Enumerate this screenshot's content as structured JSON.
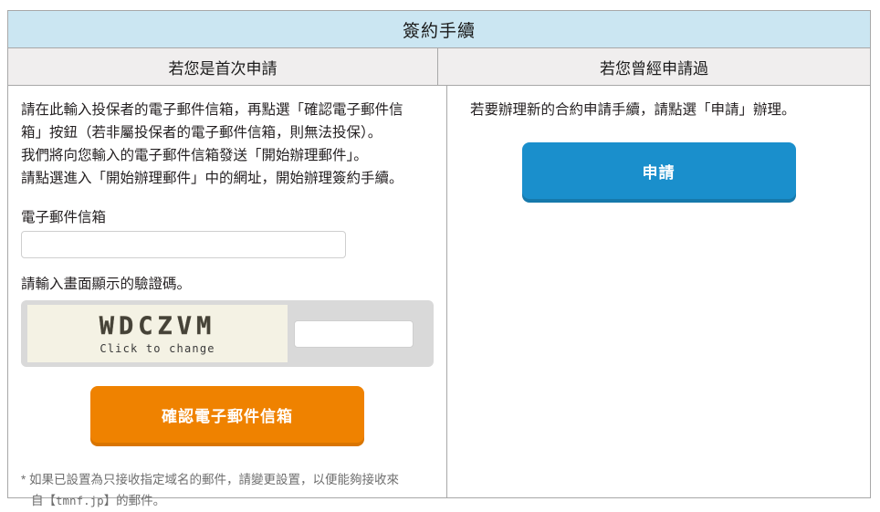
{
  "page": {
    "title": "簽約手續"
  },
  "columns": {
    "left_heading": "若您是首次申請",
    "right_heading": "若您曾經申請過"
  },
  "left": {
    "intro_lines": [
      "請在此輸入投保者的電子郵件信箱，再點選「確認電子郵件信",
      "箱」按鈕（若非屬投保者的電子郵件信箱，則無法投保）。",
      "我們將向您輸入的電子郵件信箱發送「開始辦理郵件」。",
      "請點選進入「開始辦理郵件」中的網址，開始辦理簽約手續。"
    ],
    "email_label": "電子郵件信箱",
    "email_value": "",
    "email_placeholder": "",
    "captcha_instruction": "請輸入畫面顯示的驗證碼。",
    "captcha_code": "WDCZVM",
    "captcha_hint": "Click to change",
    "captcha_answer_value": "",
    "captcha_answer_placeholder": "",
    "confirm_button": "確認電子郵件信箱",
    "footnote_lines": [
      "* 如果已設置為只接收指定域名的郵件，請變更設置，以便能夠接收來",
      "自【",
      "tmnf.jp",
      "】的郵件。"
    ]
  },
  "right": {
    "intro": "若要辦理新的合約申請手續，請點選「申請」辦理。",
    "apply_button": "申請"
  },
  "colors": {
    "title_bar": "#cbe6f2",
    "column_header": "#f0eeee",
    "border": "#a8a8a8",
    "orange_button": "#ef8200",
    "orange_button_shadow": "#d97500",
    "blue_button": "#1a8fcc",
    "blue_button_shadow": "#1679ab",
    "captcha_panel": "#d9d9d9",
    "captcha_image": "#f4f2e4",
    "footnote_text": "#6f6f6f"
  }
}
